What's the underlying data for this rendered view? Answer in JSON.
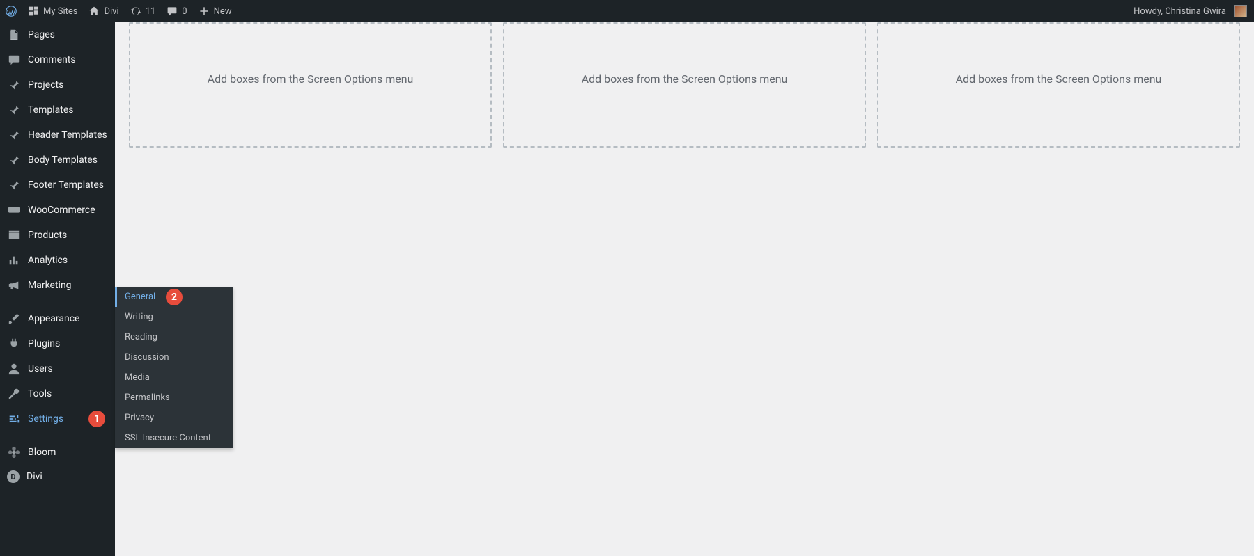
{
  "adminbar": {
    "wp_icon": "wordpress-logo",
    "my_sites": "My Sites",
    "site_name": "Divi",
    "updates_count": "11",
    "comments_count": "0",
    "new_label": "New",
    "howdy": "Howdy, Christina Gwira"
  },
  "sidebar": {
    "items": [
      {
        "id": "pages",
        "label": "Pages",
        "icon": "pages"
      },
      {
        "id": "comments",
        "label": "Comments",
        "icon": "comment"
      },
      {
        "id": "projects",
        "label": "Projects",
        "icon": "pin"
      },
      {
        "id": "templates",
        "label": "Templates",
        "icon": "pin"
      },
      {
        "id": "header-templates",
        "label": "Header Templates",
        "icon": "pin"
      },
      {
        "id": "body-templates",
        "label": "Body Templates",
        "icon": "pin"
      },
      {
        "id": "footer-templates",
        "label": "Footer Templates",
        "icon": "pin"
      },
      {
        "id": "woocommerce",
        "label": "WooCommerce",
        "icon": "woo"
      },
      {
        "id": "products",
        "label": "Products",
        "icon": "products"
      },
      {
        "id": "analytics",
        "label": "Analytics",
        "icon": "analytics"
      },
      {
        "id": "marketing",
        "label": "Marketing",
        "icon": "marketing"
      },
      {
        "id": "appearance",
        "label": "Appearance",
        "icon": "appearance"
      },
      {
        "id": "plugins",
        "label": "Plugins",
        "icon": "plugins"
      },
      {
        "id": "users",
        "label": "Users",
        "icon": "users"
      },
      {
        "id": "tools",
        "label": "Tools",
        "icon": "tools"
      },
      {
        "id": "settings",
        "label": "Settings",
        "icon": "settings"
      },
      {
        "id": "bloom",
        "label": "Bloom",
        "icon": "bloom"
      },
      {
        "id": "divi",
        "label": "Divi",
        "icon": "divi"
      }
    ],
    "settings_submenu": [
      {
        "label": "General",
        "active": true
      },
      {
        "label": "Writing"
      },
      {
        "label": "Reading"
      },
      {
        "label": "Discussion"
      },
      {
        "label": "Media"
      },
      {
        "label": "Permalinks"
      },
      {
        "label": "Privacy"
      },
      {
        "label": "SSL Insecure Content"
      }
    ]
  },
  "callouts": {
    "settings": "1",
    "general": "2"
  },
  "content": {
    "box_placeholder": "Add boxes from the Screen Options menu"
  }
}
